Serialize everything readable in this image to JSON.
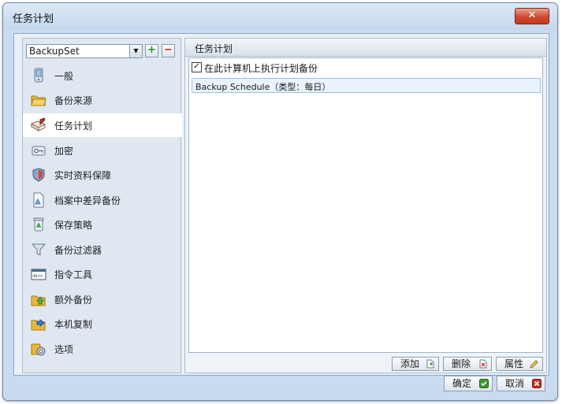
{
  "window": {
    "title": "任务计划",
    "close_symbol": "✕"
  },
  "backup_set": {
    "selected": "BackupSet",
    "add_symbol": "+",
    "remove_symbol": "−"
  },
  "nav": {
    "items": [
      {
        "label": "一般",
        "icon": "computer-icon"
      },
      {
        "label": "备份来源",
        "icon": "folder-open-icon"
      },
      {
        "label": "任务计划",
        "icon": "schedule-pen-icon",
        "active": true
      },
      {
        "label": "加密",
        "icon": "key-lock-icon"
      },
      {
        "label": "实时资料保障",
        "icon": "shield-icon"
      },
      {
        "label": "档案中差异备份",
        "icon": "document-diff-icon"
      },
      {
        "label": "保存策略",
        "icon": "recycle-bin-icon"
      },
      {
        "label": "备份过滤器",
        "icon": "funnel-icon"
      },
      {
        "label": "指令工具",
        "icon": "command-prompt-icon"
      },
      {
        "label": "额外备份",
        "icon": "extra-backup-icon"
      },
      {
        "label": "本机复制",
        "icon": "local-copy-icon"
      },
      {
        "label": "选项",
        "icon": "options-gear-icon"
      }
    ]
  },
  "panel": {
    "title": "任务计划",
    "run_checkbox_label": "在此计算机上执行计划备份",
    "run_checkbox_checked": true,
    "check_mark": "✓",
    "schedules": [
      {
        "text": "Backup Schedule（类型：每日）"
      }
    ]
  },
  "actions": {
    "add": "添加",
    "delete": "删除",
    "properties": "属性"
  },
  "footer": {
    "ok": "确定",
    "cancel": "取消"
  },
  "colors": {
    "accent": "#9cc0e4",
    "ok_green": "#3a9a2a",
    "cancel_red": "#c8311f"
  }
}
